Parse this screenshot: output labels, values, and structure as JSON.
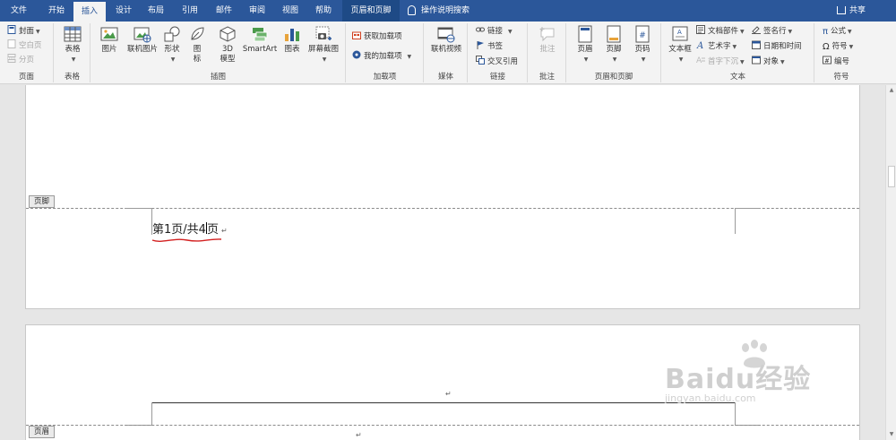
{
  "tabs": [
    {
      "label": "文件",
      "state": "normal"
    },
    {
      "label": "开始",
      "state": "normal"
    },
    {
      "label": "插入",
      "state": "active"
    },
    {
      "label": "设计",
      "state": "normal"
    },
    {
      "label": "布局",
      "state": "normal"
    },
    {
      "label": "引用",
      "state": "normal"
    },
    {
      "label": "邮件",
      "state": "normal"
    },
    {
      "label": "审阅",
      "state": "normal"
    },
    {
      "label": "视图",
      "state": "normal"
    },
    {
      "label": "帮助",
      "state": "normal"
    },
    {
      "label": "页眉和页脚",
      "state": "context"
    }
  ],
  "tell_me": "操作说明搜索",
  "share": "共享",
  "ribbon": {
    "pages": {
      "label": "页面",
      "cover": "封面",
      "blank": "空白页",
      "break": "分页"
    },
    "tables": {
      "label": "表格",
      "table": "表格"
    },
    "illustrations": {
      "label": "插图",
      "picture": "图片",
      "online_picture": "联机图片",
      "shapes": "形状",
      "icons": "图标",
      "model3d": "3D 模型",
      "smartart": "SmartArt",
      "chart": "图表",
      "screenshot": "屏幕截图"
    },
    "addins": {
      "label": "加载项",
      "get": "获取加载项",
      "my": "我的加载项"
    },
    "media": {
      "label": "媒体",
      "online_video": "联机视频"
    },
    "links": {
      "label": "链接",
      "link": "链接",
      "bookmark": "书签",
      "cross_ref": "交叉引用"
    },
    "comments": {
      "label": "批注",
      "comment": "批注"
    },
    "header_footer": {
      "label": "页眉和页脚",
      "header": "页眉",
      "footer": "页脚",
      "page_number": "页码"
    },
    "text": {
      "label": "文本",
      "textbox": "文本框",
      "quick_parts": "文档部件",
      "wordart": "艺术字",
      "dropcap": "首字下沉",
      "signature": "签名行",
      "datetime": "日期和时间",
      "object": "对象"
    },
    "symbols": {
      "label": "符号",
      "equation": "公式",
      "symbol": "符号",
      "number": "编号"
    }
  },
  "document": {
    "footer_tag": "页脚",
    "header_tag": "页眉",
    "page_number_text_a": "第1页/共4",
    "page_number_text_b": "页",
    "para_mark": "↵"
  },
  "colors": {
    "accent": "#2b579a",
    "underline": "#d32020"
  },
  "watermark": {
    "text": "Baidu经验",
    "sub": "jingyan.baidu.com"
  }
}
